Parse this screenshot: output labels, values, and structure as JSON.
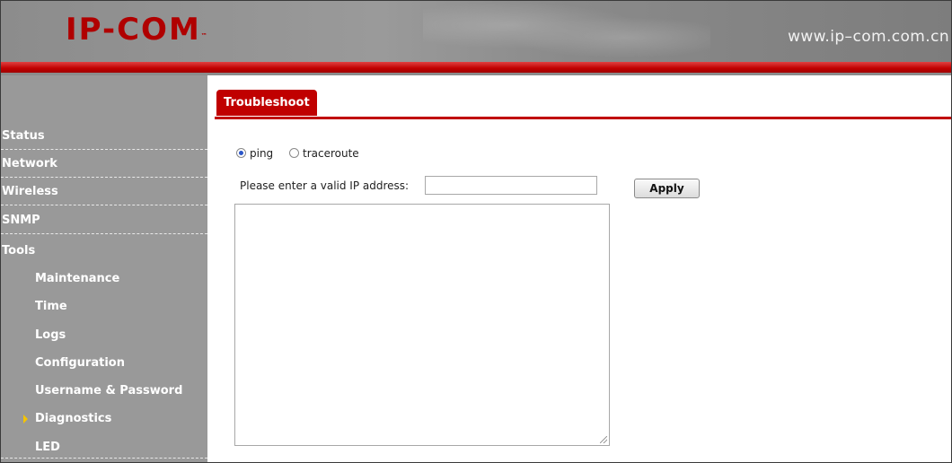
{
  "header": {
    "logo_text": "IP-COM",
    "logo_mark": "™",
    "url": "www.ip–com.com.cn"
  },
  "colors": {
    "brand_red": "#c00000",
    "sidebar_gray": "#999999",
    "header_gray": "#8c8c8c",
    "active_arrow": "#f5c400"
  },
  "sidebar": {
    "items": [
      {
        "label": "Status"
      },
      {
        "label": "Network"
      },
      {
        "label": "Wireless"
      },
      {
        "label": "SNMP"
      },
      {
        "label": "Tools"
      }
    ],
    "sub_items": [
      {
        "label": "Maintenance"
      },
      {
        "label": "Time"
      },
      {
        "label": "Logs"
      },
      {
        "label": "Configuration"
      },
      {
        "label": "Username & Password"
      },
      {
        "label": "Diagnostics",
        "active": true
      },
      {
        "label": "LED"
      }
    ],
    "active_icon": "triangle-right-icon"
  },
  "main": {
    "tab_label": "Troubleshoot",
    "radio_options": [
      {
        "label": "ping",
        "checked": true
      },
      {
        "label": "traceroute",
        "checked": false
      }
    ],
    "ip_label": "Please enter a valid IP address:",
    "ip_value": "",
    "apply_label": "Apply",
    "output_text": ""
  }
}
